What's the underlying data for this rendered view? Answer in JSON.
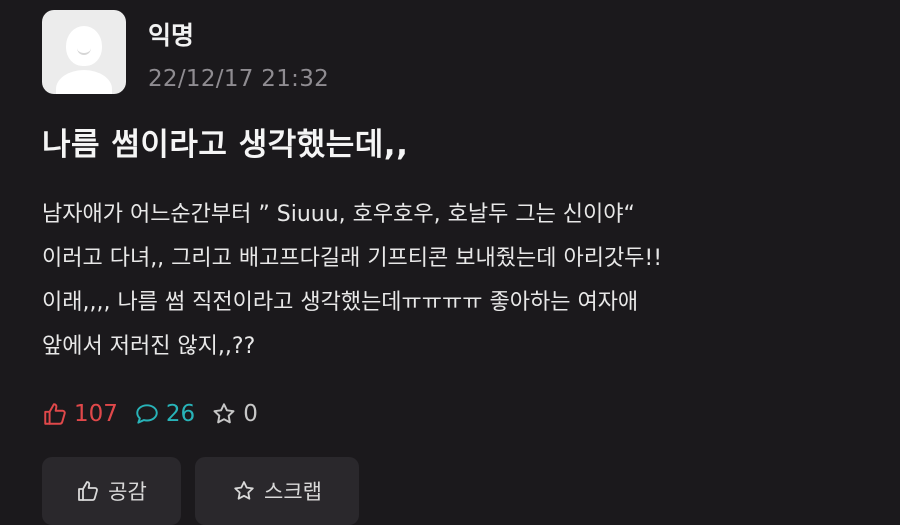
{
  "author": {
    "name": "익명",
    "date": "22/12/17 21:32",
    "avatar_icon": "anonymous-user-icon"
  },
  "post": {
    "title": "나름 썸이라고 생각했는데,,",
    "body_lines": [
      "남자애가 어느순간부터 ” Siuuu, 호우호우, 호날두 그는 신이야“",
      "이러고 다녀,, 그리고 배고프다길래 기프티콘 보내줬는데 아리갓두!!",
      "이래,,,, 나름 썸 직전이라고 생각했는데ㅠㅠㅠㅠ 좋아하는 여자애",
      "앞에서 저러진 않지,,??"
    ]
  },
  "stats": {
    "likes": "107",
    "comments": "26",
    "scraps": "0",
    "like_icon": "thumbs-up-icon",
    "comment_icon": "speech-bubble-icon",
    "scrap_icon": "star-icon",
    "colors": {
      "likes": "#e0484a",
      "comments": "#28b3b8",
      "scraps": "#c7c7c7"
    }
  },
  "actions": {
    "like_label": "공감",
    "scrap_label": "스크랩"
  }
}
